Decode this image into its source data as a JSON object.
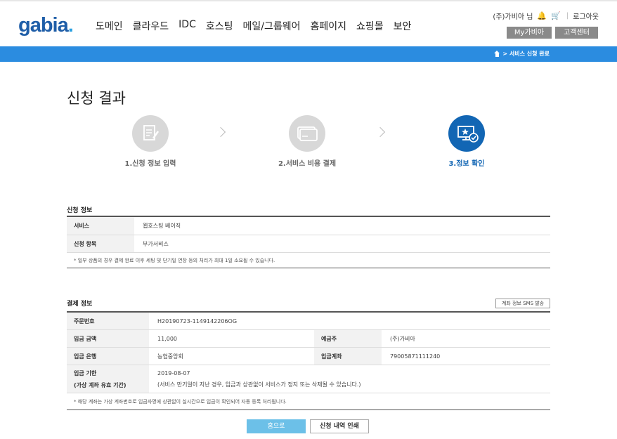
{
  "header": {
    "logo": "gabia",
    "logo_dot": ".",
    "nav": [
      "도메인",
      "클라우드",
      "IDC",
      "호스팅",
      "메일/그룹웨어",
      "홈페이지",
      "쇼핑몰",
      "보안"
    ],
    "user": "(주)가비아 님",
    "logout": "로그아웃",
    "my_button": "My가비아",
    "cs_button": "고객센터"
  },
  "breadcrumb": {
    "current": "> 서비스 신청 완료"
  },
  "page_title": "신청 결과",
  "steps": [
    {
      "label": "1.신청 정보 입력",
      "icon": "document-edit-icon",
      "active": false
    },
    {
      "label": "2.서비스 비용 결제",
      "icon": "credit-card-icon",
      "active": false
    },
    {
      "label": "3.정보 확인",
      "icon": "monitor-check-icon",
      "active": true
    }
  ],
  "application": {
    "title": "신청 정보",
    "rows": [
      {
        "label": "서비스",
        "value": "웹호스팅 베이직"
      },
      {
        "label": "신청 항목",
        "value": "부가서비스"
      }
    ],
    "note": "* 일부 상품의 경우 결제 완료 이후 세팅 및 단기일 연장 등의 처리가 최대 1일 소요될 수 있습니다."
  },
  "payment": {
    "title": "결제 정보",
    "sms_button": "계좌 정보 SMS 발송",
    "order_label": "주문번호",
    "order_value": "H20190723-1149142206OG",
    "amount_label": "입금 금액",
    "amount_value": "11,000",
    "depositor_label": "예금주",
    "depositor_value": "(주)가비아",
    "bank_label": "입금 은행",
    "bank_value": "농협중앙회",
    "account_label": "입금계좌",
    "account_value": "79005871111240",
    "deadline_label_1": "입금 기한",
    "deadline_label_2": "(가상 계좌 유효 기간)",
    "deadline_value": "2019-08-07",
    "deadline_note": "(서비스 만기일이 지난 경우, 입금과 상관없이 서비스가 정지 또는 삭제될 수 있습니다.)",
    "note": "* 해당 계좌는 가상 계좌번호로 입금자명에 상관없이 실시간으로 입금이 확인되어 자동 등록 처리됩니다."
  },
  "buttons": {
    "home": "홈으로",
    "print": "신청 내역 인쇄"
  },
  "colors": {
    "brand": "#1f5ea8",
    "bar": "#2b8ce0",
    "active_step": "#1266b4",
    "home_button": "#6cc0e8"
  }
}
